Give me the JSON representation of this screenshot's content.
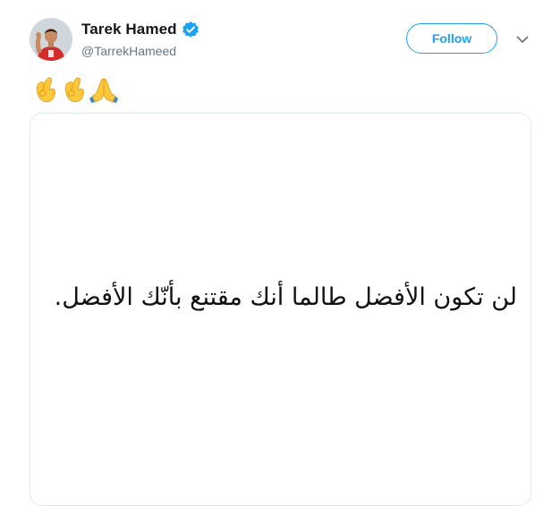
{
  "user": {
    "display_name": "Tarek Hamed",
    "handle": "@TarrekHameed",
    "verified_icon": "verified-badge-icon",
    "avatar_icon": "football-player-avatar"
  },
  "actions": {
    "follow_label": "Follow",
    "menu_icon": "chevron-down-icon"
  },
  "tweet": {
    "emojis": [
      "ok-hand",
      "ok-hand",
      "folded-hands"
    ]
  },
  "media": {
    "quote": "لن تكون الأفضل طالما أنك مقتنع بأنّك الأفضل."
  },
  "colors": {
    "accent": "#1da1f2",
    "text_primary": "#14171a",
    "text_secondary": "#657786",
    "border": "#e1e8ed"
  }
}
